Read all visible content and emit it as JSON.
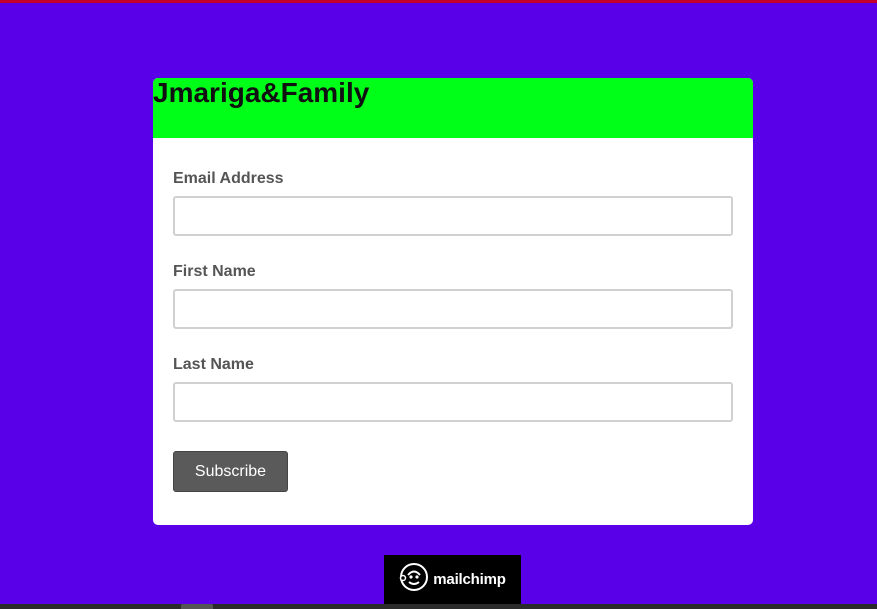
{
  "form": {
    "title": "Jmariga&Family",
    "fields": [
      {
        "label": "Email Address",
        "value": "",
        "placeholder": ""
      },
      {
        "label": "First Name",
        "value": "",
        "placeholder": ""
      },
      {
        "label": "Last Name",
        "value": "",
        "placeholder": ""
      }
    ],
    "submit_label": "Subscribe"
  },
  "badge": {
    "text": "mailchimp",
    "icon": "freddie-monkey-icon"
  },
  "colors": {
    "background": "#5a00e8",
    "header": "#00ff18",
    "button": "#5a5a5a",
    "top_bar": "#c3002a"
  }
}
